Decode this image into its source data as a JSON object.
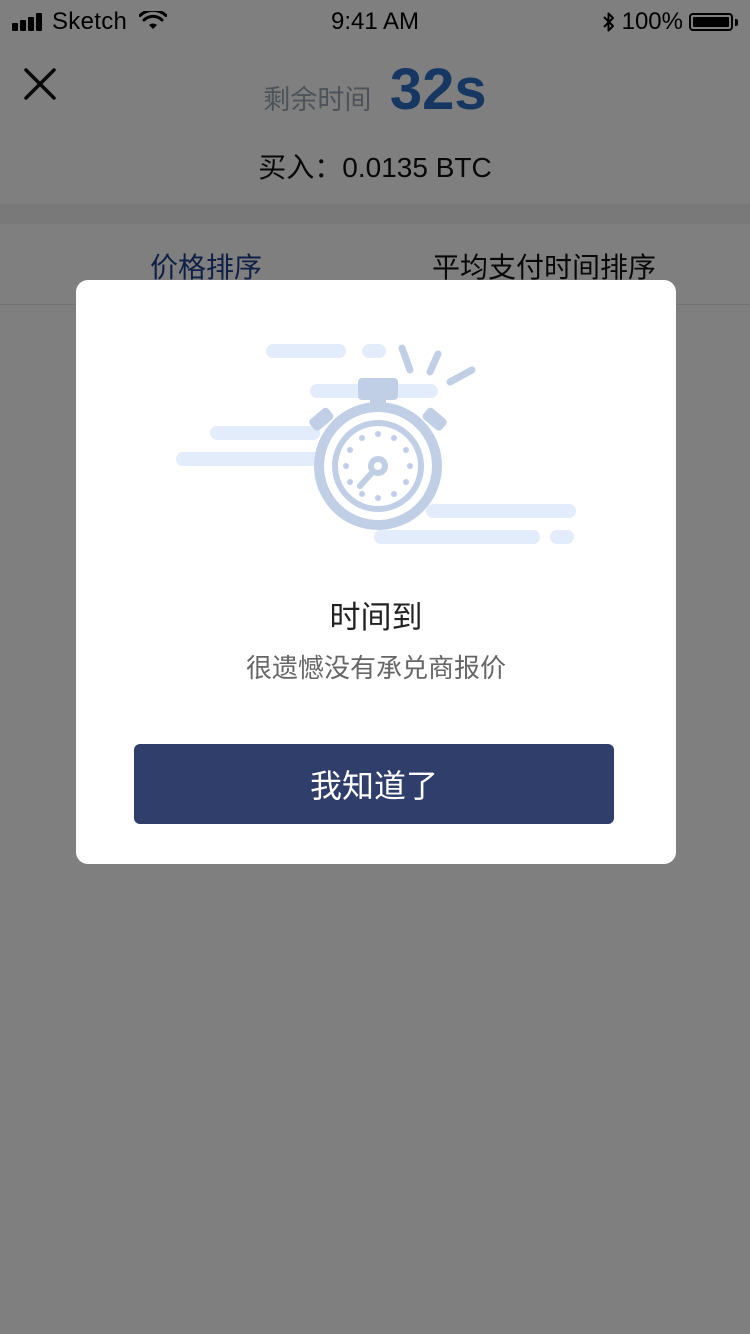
{
  "status_bar": {
    "carrier": "Sketch",
    "time": "9:41 AM",
    "battery": "100%",
    "icons": [
      "signal-icon",
      "wifi-icon",
      "bluetooth-icon",
      "battery-icon"
    ]
  },
  "header": {
    "close_icon": "close-icon",
    "timer_label": "剩余时间",
    "timer_value": "32s",
    "buy_text": "买入：0.0135 BTC"
  },
  "tabs": [
    {
      "label": "价格排序",
      "active": true
    },
    {
      "label": "平均支付时间排序",
      "active": false
    }
  ],
  "modal": {
    "illustration_icon": "stopwatch-icon",
    "title": "时间到",
    "message": "很遗憾没有承兑商报价",
    "button_label": "我知道了"
  },
  "colors": {
    "accent_blue": "#2f6fc7",
    "button_navy": "#2f3e6b",
    "tab_active": "#1f3f8a",
    "illustration_light": "#e3ecfb",
    "illustration_mid": "#c1cfe6"
  }
}
